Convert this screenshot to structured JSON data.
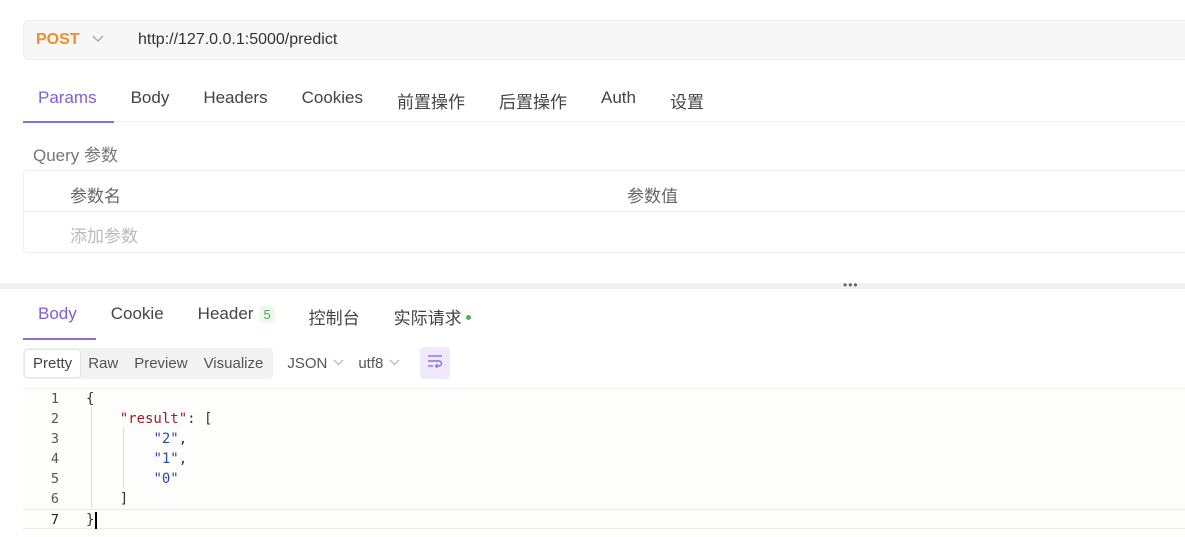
{
  "request": {
    "method": "POST",
    "url": "http://127.0.0.1:5000/predict"
  },
  "request_tabs": [
    "Params",
    "Body",
    "Headers",
    "Cookies",
    "前置操作",
    "后置操作",
    "Auth",
    "设置"
  ],
  "params": {
    "section_title": "Query 参数",
    "col_name": "参数名",
    "col_value": "参数值",
    "add_placeholder": "添加参数"
  },
  "response_tabs": {
    "body": "Body",
    "cookie": "Cookie",
    "header": "Header",
    "header_count": "5",
    "console": "控制台",
    "actual_request": "实际请求"
  },
  "toolbar": {
    "views": [
      "Pretty",
      "Raw",
      "Preview",
      "Visualize"
    ],
    "format": "JSON",
    "encoding": "utf8"
  },
  "code": {
    "line_numbers": [
      "1",
      "2",
      "3",
      "4",
      "5",
      "6",
      "7"
    ],
    "lines": [
      "{",
      "    \"result\": [",
      "        \"2\",",
      "        \"1\",",
      "        \"0\"",
      "    ]",
      "}"
    ],
    "result_key": "\"result\"",
    "values": [
      "\"2\"",
      "\"1\"",
      "\"0\""
    ]
  },
  "colors": {
    "accent": "#7a5fd8",
    "method": "#f08c2a",
    "json_key": "#a01b2c",
    "json_string": "#2a4aa8",
    "status_dot": "#4caf50"
  }
}
